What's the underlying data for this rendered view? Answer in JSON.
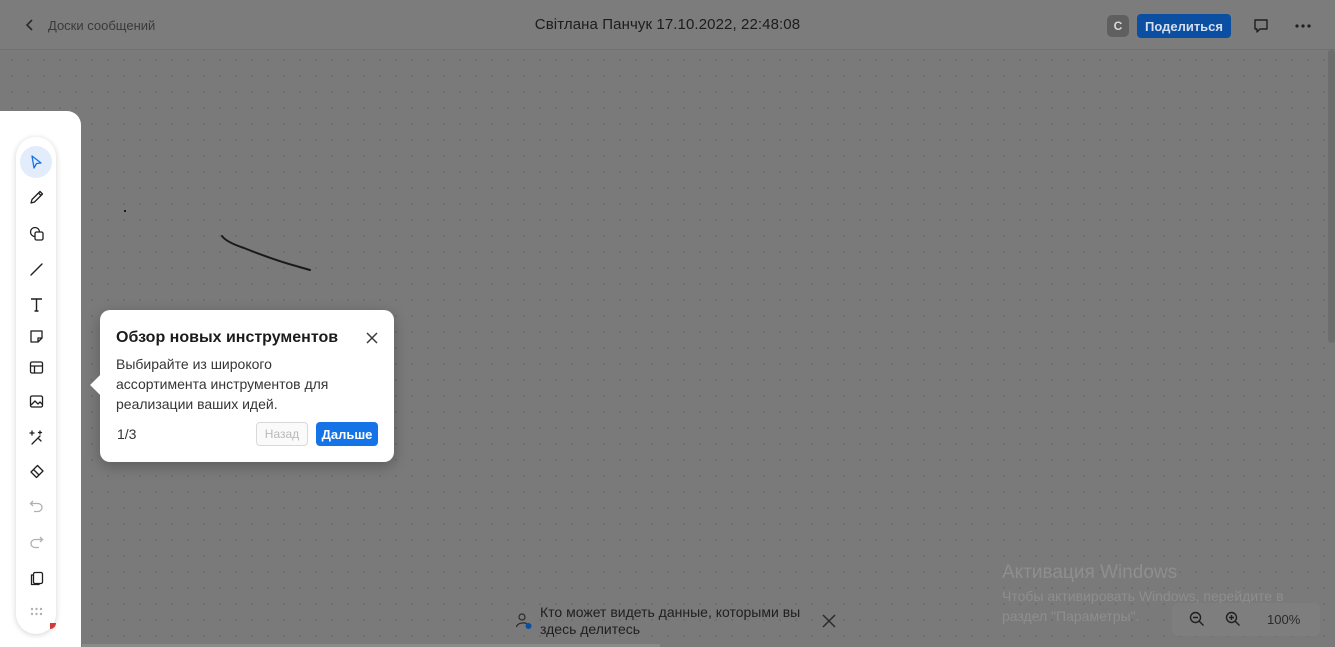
{
  "header": {
    "back_label": "Доски сообщений",
    "title": "Світлана Панчук 17.10.2022, 22:48:08",
    "avatar_initial": "С",
    "share_label": "Поделиться"
  },
  "toolbar": {
    "tools": [
      {
        "name": "select-tool",
        "icon": "cursor-arrow-icon",
        "active": true
      },
      {
        "name": "pen-tool",
        "icon": "pencil-icon"
      },
      {
        "name": "shapes-tool",
        "icon": "shapes-icon"
      },
      {
        "name": "line-tool",
        "icon": "line-icon"
      },
      {
        "name": "text-tool",
        "icon": "text-t-icon"
      },
      {
        "name": "note-tool",
        "icon": "sticky-note-icon"
      },
      {
        "name": "template-tool",
        "icon": "template-layout-icon"
      },
      {
        "name": "image-tool",
        "icon": "image-icon"
      },
      {
        "name": "ai-tool",
        "icon": "sparkle-wand-icon"
      },
      {
        "name": "eraser-tool",
        "icon": "eraser-icon"
      },
      {
        "name": "undo-tool",
        "icon": "undo-icon",
        "disabled": true
      },
      {
        "name": "redo-tool",
        "icon": "redo-icon",
        "disabled": true
      },
      {
        "name": "copy-tool",
        "icon": "copy-layers-icon"
      },
      {
        "name": "more-tools",
        "icon": "grid-dots-icon"
      }
    ]
  },
  "popover": {
    "title": "Обзор новых инструментов",
    "body": "Выбирайте из широкого ассортимента инструментов для реализации ваших идей.",
    "counter": "1/3",
    "back_label": "Назад",
    "next_label": "Дальше"
  },
  "privacy_notice": {
    "text": "Кто может видеть данные, которыми вы здесь делитесь"
  },
  "windows_activation": {
    "title": "Активация Windows",
    "body": "Чтобы активировать Windows, перейдите в раздел \"Параметры\"."
  },
  "zoom": {
    "level": "100%"
  },
  "colors": {
    "accent": "#1473e6",
    "share_button": "#0b4fa3",
    "overlay_background": "#7a7a7a"
  }
}
